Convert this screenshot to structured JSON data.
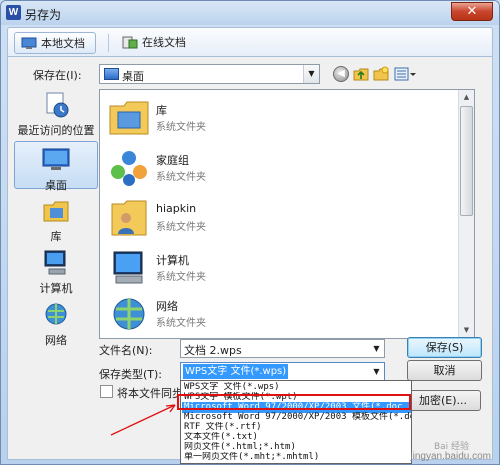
{
  "window": {
    "title": "另存为",
    "app_icon": "W",
    "close": "✕"
  },
  "tabs": {
    "local": "本地文档",
    "cloud": "在线文档"
  },
  "save_in": {
    "label": "保存在(I):",
    "value": "桌面"
  },
  "places": [
    {
      "label": "最近访问的位置",
      "icon": "recent-places-icon"
    },
    {
      "label": "桌面",
      "icon": "desktop-icon"
    },
    {
      "label": "库",
      "icon": "libraries-icon"
    },
    {
      "label": "计算机",
      "icon": "computer-icon"
    },
    {
      "label": "网络",
      "icon": "network-icon"
    }
  ],
  "files": [
    {
      "name": "库",
      "type": "系统文件夹",
      "icon": "libraries-folder-icon"
    },
    {
      "name": "家庭组",
      "type": "系统文件夹",
      "icon": "homegroup-icon"
    },
    {
      "name": "hiapkin",
      "type": "系统文件夹",
      "icon": "user-folder-icon"
    },
    {
      "name": "计算机",
      "type": "系统文件夹",
      "icon": "computer-icon"
    },
    {
      "name": "网络",
      "type": "系统文件夹",
      "icon": "network-icon"
    }
  ],
  "filename": {
    "label": "文件名(N):",
    "value": "文档 2.wps"
  },
  "filetype": {
    "label": "保存类型(T):",
    "value": "WPS文字 文件(*.wps)"
  },
  "buttons": {
    "save": "保存(S)",
    "cancel": "取消",
    "encrypt": "加密(E)..."
  },
  "sync_label": "将本文件同步备",
  "dropdown": [
    "WPS文字 文件(*.wps)",
    "WPS文字 模板文件(*.wpt)",
    "Microsoft Word 97/2000/XP/2003 文件(*.doc",
    "Microsoft Word 97/2000/XP/2003 模板文件(*.do",
    "RTF 文件(*.rtf)",
    "文本文件(*.txt)",
    "网页文件(*.html;*.htm)",
    "单一网页文件(*.mht;*.mhtml)"
  ],
  "watermark": {
    "main": "jingyan.baidu.com",
    "sub": "Bai 经验"
  },
  "colors": {
    "highlight": "#3399ff",
    "annotation": "#e01010"
  }
}
